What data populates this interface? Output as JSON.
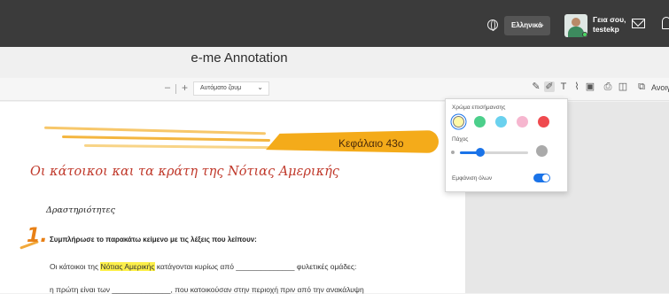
{
  "header": {
    "language": "Ελληνικά",
    "greeting": "Γεια σου,",
    "username": "testekp",
    "icons": [
      "globe-icon",
      "chevron-down-icon",
      "avatar",
      "mail-icon",
      "bell-icon"
    ]
  },
  "page": {
    "title": "e-me Annotation"
  },
  "toolbar": {
    "zoom_minus": "–",
    "zoom_plus": "+",
    "zoom_value": "Αυτόματο ζουμ",
    "tools": [
      "highlight-icon",
      "draw-icon",
      "text-icon",
      "pen-icon",
      "image-icon",
      "print-icon",
      "save-icon",
      "open-icon"
    ],
    "open_label": "Ανοιγμ"
  },
  "highlight_popup": {
    "color_label": "Χρώμα επισήμανσης",
    "colors": [
      "#fff9a8",
      "#4ccf8b",
      "#6ad1ee",
      "#f6b6cf",
      "#ef4a4f"
    ],
    "selected_color": 0,
    "thickness_label": "Πάχος",
    "thickness": 0.3,
    "show_all_label": "Εμφάνιση όλων",
    "show_all_on": true,
    "accent": "#1a73e8"
  },
  "document": {
    "chapter": "Κεφάλαιο 43ο",
    "heading": "Οι κάτοικοι και τα κράτη της Νότιας Αμερικής",
    "subheading": "Δραστηριότητες",
    "exercise_number": "1.",
    "exercise_title": "Συμπλήρωσε το παρακάτω κείμενο με τις λέξεις που λείπουν:",
    "line1_pre": "Οι κάτοικοι της ",
    "line1_highlight": "Νότιας Αμερικής",
    "line1_post": " κατάγονται κυρίως από ______________ φυλετικές ομάδες:",
    "line2": "η πρώτη είναι των ______________, που κατοικούσαν στην περιοχή πριν από την ανακάλυψη"
  }
}
